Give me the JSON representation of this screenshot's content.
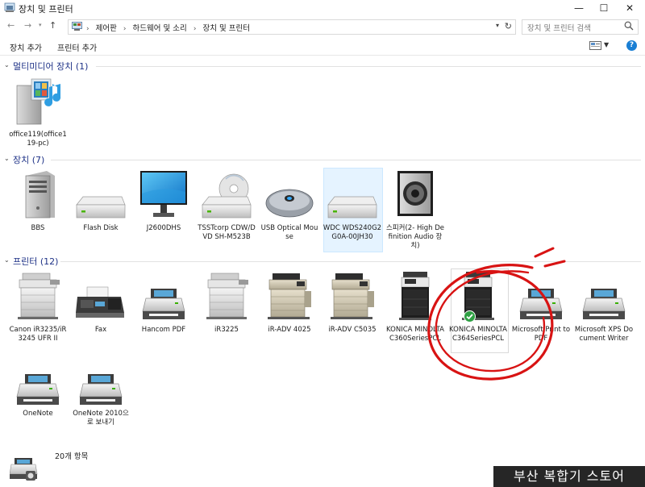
{
  "window": {
    "title": "장치 및 프린터",
    "minimize": "—",
    "maximize": "☐",
    "close": "✕"
  },
  "address": {
    "crumbs": [
      "제어판",
      "하드웨어 및 소리",
      "장치 및 프린터"
    ],
    "search_placeholder": "장치 및 프린터 검색"
  },
  "commands": {
    "add_device": "장치 추가",
    "add_printer": "프린터 추가",
    "help": "?"
  },
  "groups": {
    "multimedia": {
      "title": "멀티미디어 장치 (1)",
      "items": [
        {
          "label": "office119(office119-pc)",
          "icon": "media-server-icon"
        }
      ]
    },
    "devices": {
      "title": "장치 (7)",
      "items": [
        {
          "label": "BBS",
          "icon": "computer-tower-icon"
        },
        {
          "label": "Flash Disk",
          "icon": "drive-icon"
        },
        {
          "label": "J2600DHS",
          "icon": "monitor-icon"
        },
        {
          "label": "TSSTcorp CDW/DVD SH-M523B",
          "icon": "optical-drive-icon"
        },
        {
          "label": "USB Optical Mouse",
          "icon": "mouse-icon"
        },
        {
          "label": "WDC WDS240G2G0A-00JH30",
          "icon": "drive-icon"
        },
        {
          "label": "스피커(2- High Definition Audio 장치)",
          "icon": "speaker-icon"
        }
      ]
    },
    "printers": {
      "title": "프린터 (12)",
      "items": [
        {
          "label": "Canon iR3235/iR3245 UFR II",
          "icon": "copier-icon"
        },
        {
          "label": "Fax",
          "icon": "fax-icon"
        },
        {
          "label": "Hancom PDF",
          "icon": "printer-icon"
        },
        {
          "label": "iR3225",
          "icon": "copier-icon"
        },
        {
          "label": "iR-ADV 4025",
          "icon": "copier-icon"
        },
        {
          "label": "iR-ADV C5035",
          "icon": "copier-icon"
        },
        {
          "label": "KONICA MINOLTA C360SeriesPCL",
          "icon": "mfp-icon"
        },
        {
          "label": "KONICA MINOLTA C364SeriesPCL",
          "icon": "mfp-icon",
          "default": true
        },
        {
          "label": "Microsoft Print to PDF",
          "icon": "printer-icon"
        },
        {
          "label": "Microsoft XPS Document Writer",
          "icon": "printer-icon"
        },
        {
          "label": "OneNote",
          "icon": "printer-icon"
        },
        {
          "label": "OneNote 2010으로 보내기",
          "icon": "printer-icon"
        }
      ]
    }
  },
  "status": {
    "count": "20개 항목"
  },
  "watermark": "부산 복합기 스토어",
  "colors": {
    "group_title": "#1e3287",
    "annotation": "#d81313",
    "selection": "#e5f3ff",
    "default_check": "#2ea043"
  }
}
